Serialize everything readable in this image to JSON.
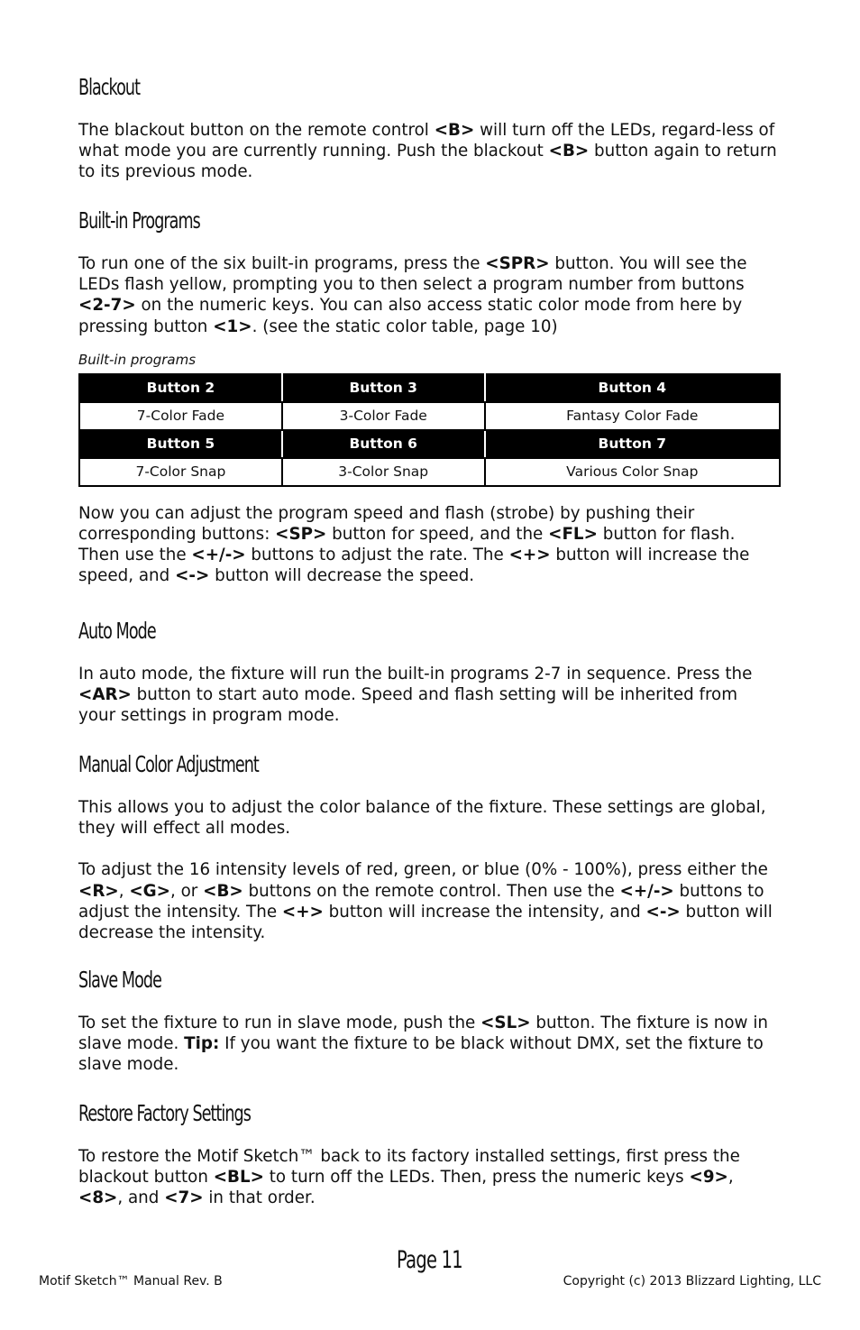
{
  "sections": {
    "blackout": {
      "title": "Blackout",
      "p1": [
        "The blackout button on the remote control ",
        "<B>",
        " will turn off the LEDs, regard-less of what mode you are currently running. Push the blackout ",
        "<B>",
        " button again to return to its previous mode."
      ]
    },
    "builtin": {
      "title": "Built-in Programs",
      "p1": [
        "To run one of the six built-in programs, press the ",
        "<SPR>",
        " button. You will see the LEDs flash yellow, prompting you to then select a program number from buttons ",
        "<2-7>",
        " on the numeric keys. You can also access static color mode from here by pressing button ",
        "<1>",
        ". (see the static color table, page 10)"
      ],
      "caption": "Built-in programs",
      "table": [
        {
          "headers": [
            "Button 2",
            "Button 3",
            "Button 4"
          ],
          "values": [
            "7-Color Fade",
            "3-Color Fade",
            "Fantasy Color Fade"
          ]
        },
        {
          "headers": [
            "Button 5",
            "Button 6",
            "Button 7"
          ],
          "values": [
            "7-Color Snap",
            "3-Color Snap",
            "Various Color Snap"
          ]
        }
      ],
      "p2": [
        "Now you can adjust the program speed and flash (strobe) by pushing their corresponding buttons: ",
        "<SP>",
        " button for speed, and the ",
        "<FL>",
        " button for flash. Then use the ",
        "<+/->",
        " buttons to adjust the rate. The ",
        "<+>",
        " button will increase the speed, and ",
        "<->",
        " button will decrease the speed."
      ]
    },
    "auto": {
      "title": "Auto Mode",
      "p1": [
        "In auto mode, the fixture will run the built-in programs 2-7 in sequence. Press the ",
        "<AR>",
        " button to start auto mode. Speed and flash setting will be inherited from your settings in program mode."
      ]
    },
    "manual": {
      "title": "Manual Color Adjustment",
      "p1": [
        "This allows you to adjust the color balance of the fixture. These settings are global, they will effect all modes."
      ],
      "p2": [
        "To adjust the 16 intensity levels of red, green, or blue (0% - 100%), press either the ",
        "<R>",
        ", ",
        "<G>",
        ", or ",
        "<B>",
        " buttons on the remote control. Then use the ",
        "<+/->",
        " buttons to adjust the intensity. The ",
        "<+>",
        " button will increase the intensity, and ",
        "<->",
        " button will decrease the intensity."
      ]
    },
    "slave": {
      "title": "Slave Mode",
      "p1": [
        "To set the fixture to run in slave mode, push the ",
        "<SL>",
        " button. The fixture is now in slave mode. ",
        "Tip:",
        " If you want the fixture to be black without DMX, set the fixture to slave mode."
      ]
    },
    "restore": {
      "title": "Restore Factory Settings",
      "p1": [
        "To restore the Motif Sketch™ back to its factory installed settings, first press the blackout button ",
        "<BL>",
        " to turn off the LEDs. Then, press the numeric keys ",
        "<9>",
        ", ",
        "<8>",
        ", and ",
        "<7>",
        " in that order."
      ]
    }
  },
  "footer": {
    "page": "Page 11",
    "left": "Motif Sketch™ Manual Rev. B",
    "right": "Copyright (c) 2013 Blizzard Lighting, LLC"
  }
}
